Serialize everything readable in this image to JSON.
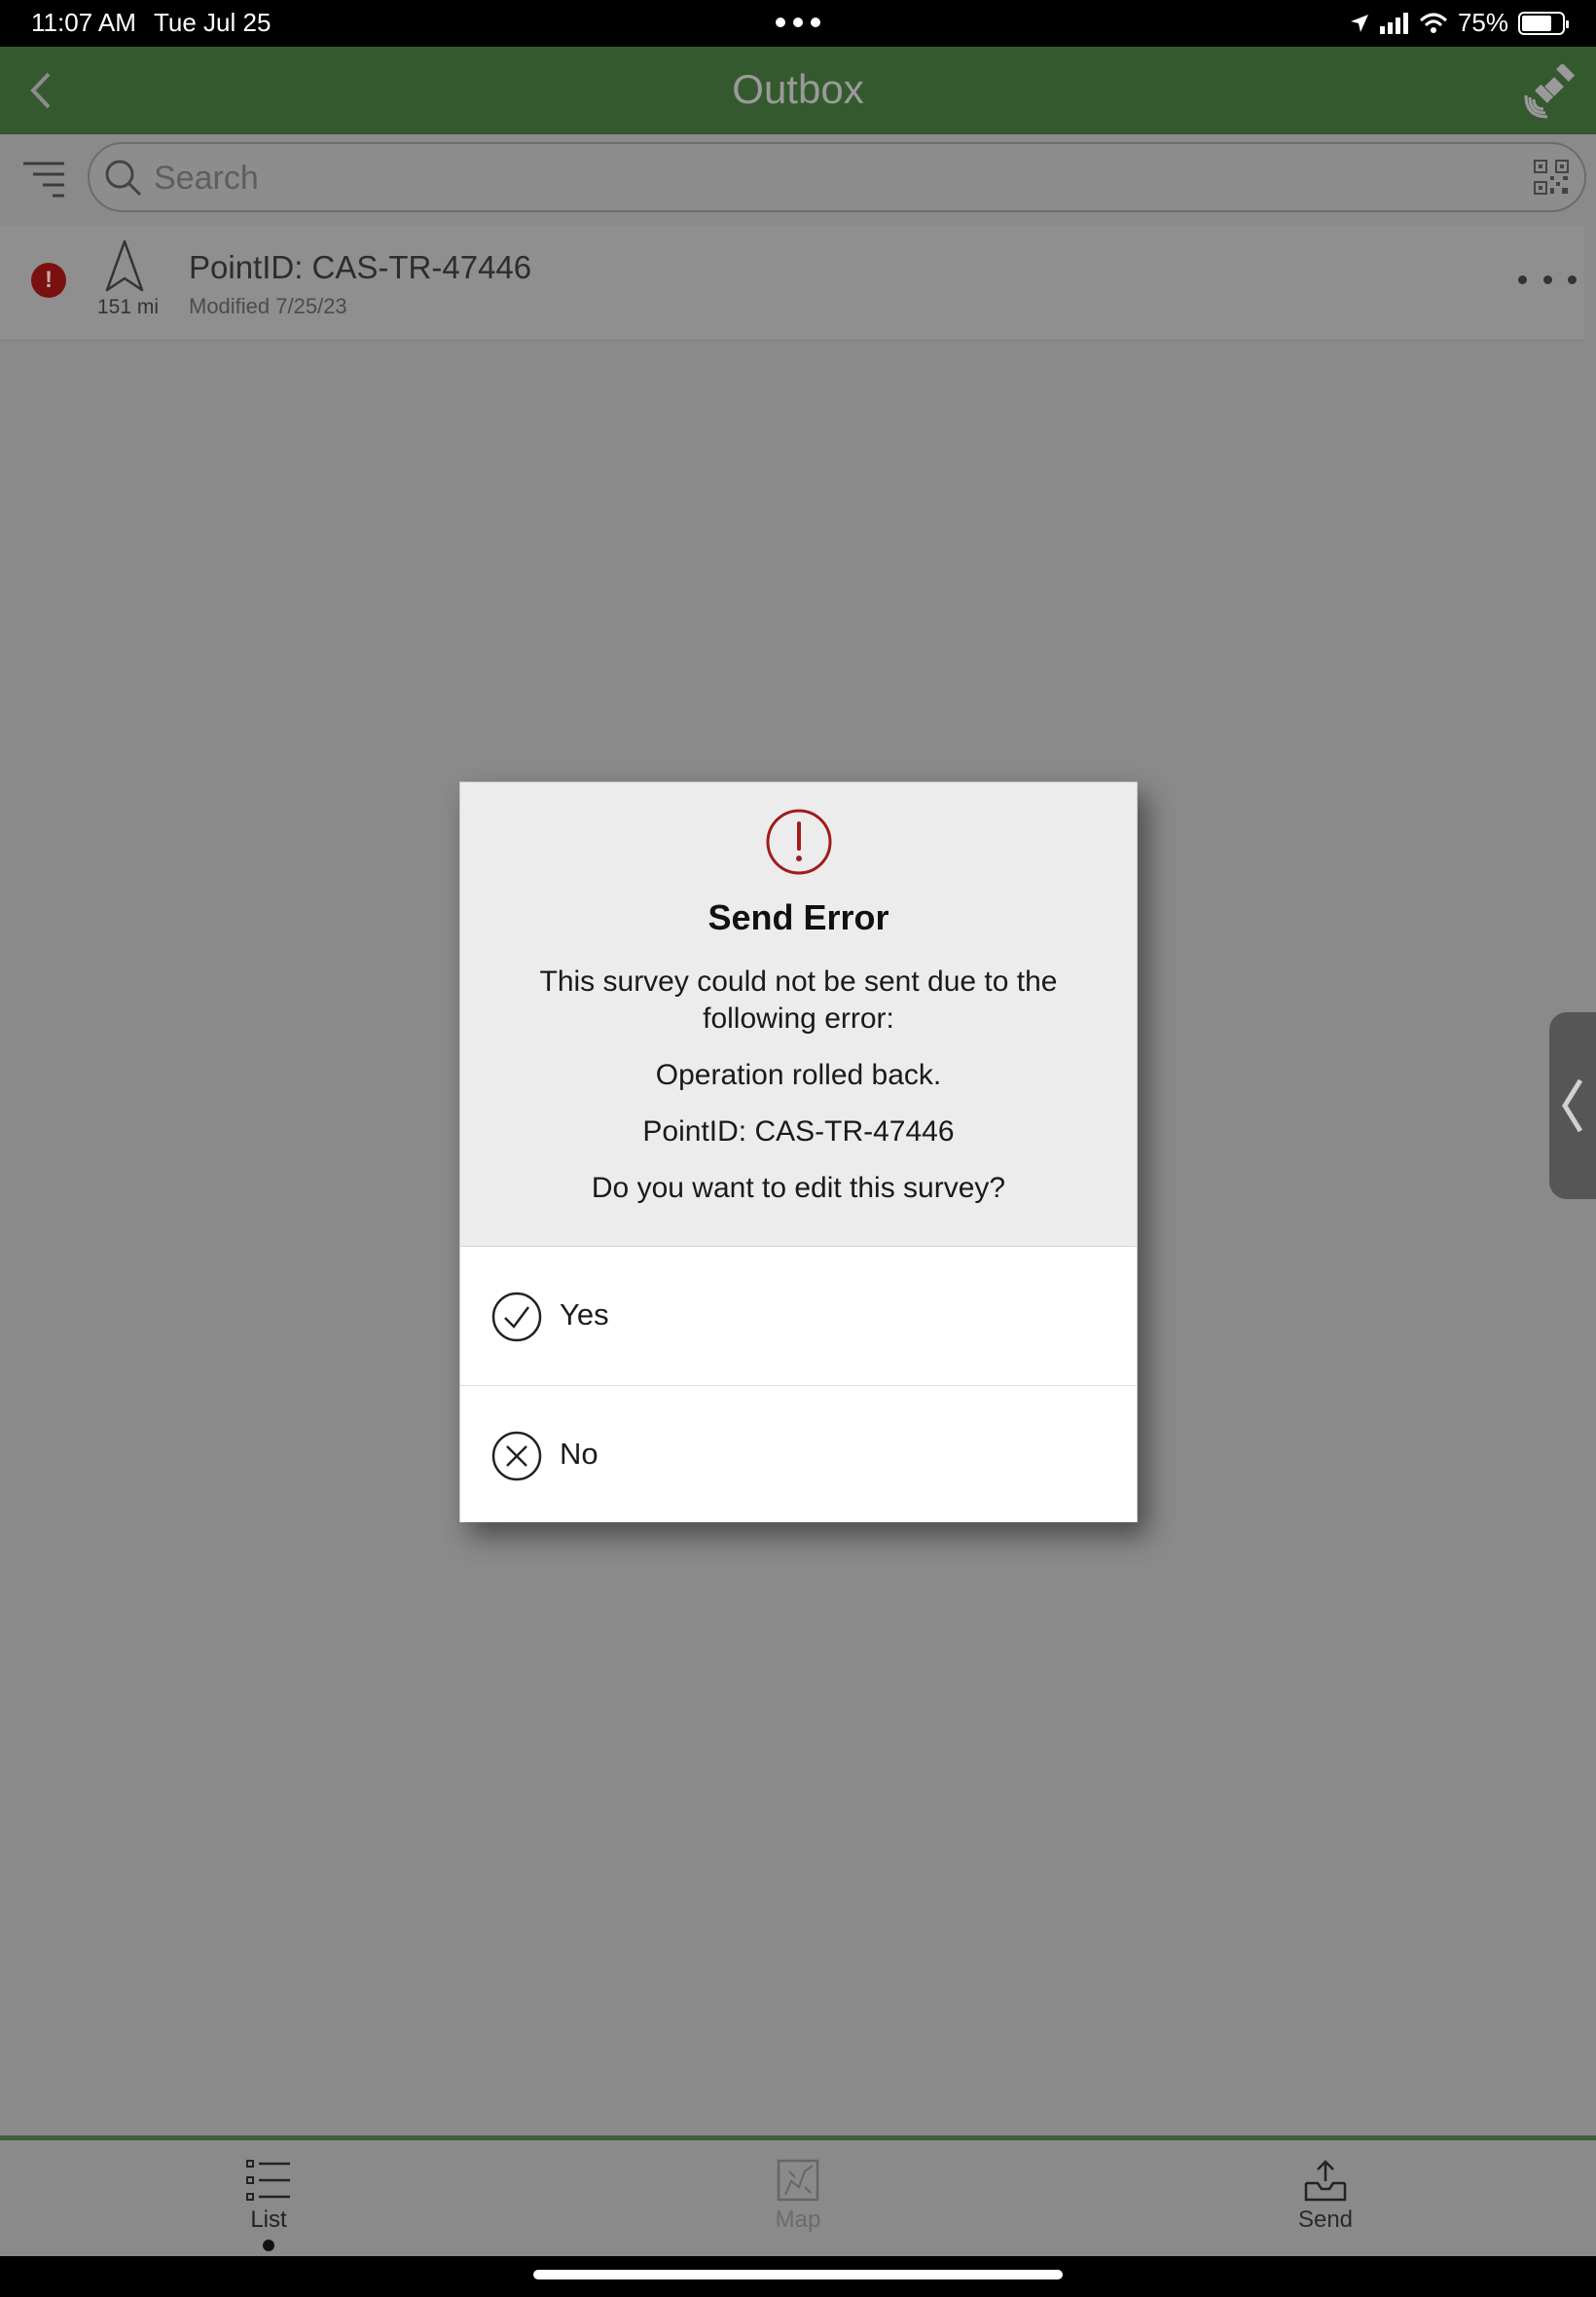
{
  "status_bar": {
    "time": "11:07 AM",
    "date": "Tue Jul 25",
    "battery": "75%",
    "battery_level": 0.75
  },
  "header": {
    "title": "Outbox",
    "back_icon": "chevron-left-icon",
    "gps_icon": "satellite-icon"
  },
  "search": {
    "placeholder": "Search"
  },
  "list": {
    "items": [
      {
        "title": "PointID: CAS-TR-47446",
        "subtitle": "Modified 7/25/23",
        "distance": "151 mi",
        "error_badge": "!"
      }
    ]
  },
  "dialog": {
    "title": "Send Error",
    "message": "This survey could not be sent due to the following error:",
    "error": "Operation rolled back.",
    "record": "PointID: CAS-TR-47446",
    "question": "Do you want to edit this survey?",
    "options": [
      {
        "label": "Yes",
        "icon": "check-circle-icon"
      },
      {
        "label": "No",
        "icon": "x-circle-icon"
      }
    ],
    "accent_color": "#a01c1c"
  },
  "tabs": [
    {
      "label": "List",
      "active": true
    },
    {
      "label": "Map",
      "active": false
    },
    {
      "label": "Send",
      "active": false
    }
  ]
}
